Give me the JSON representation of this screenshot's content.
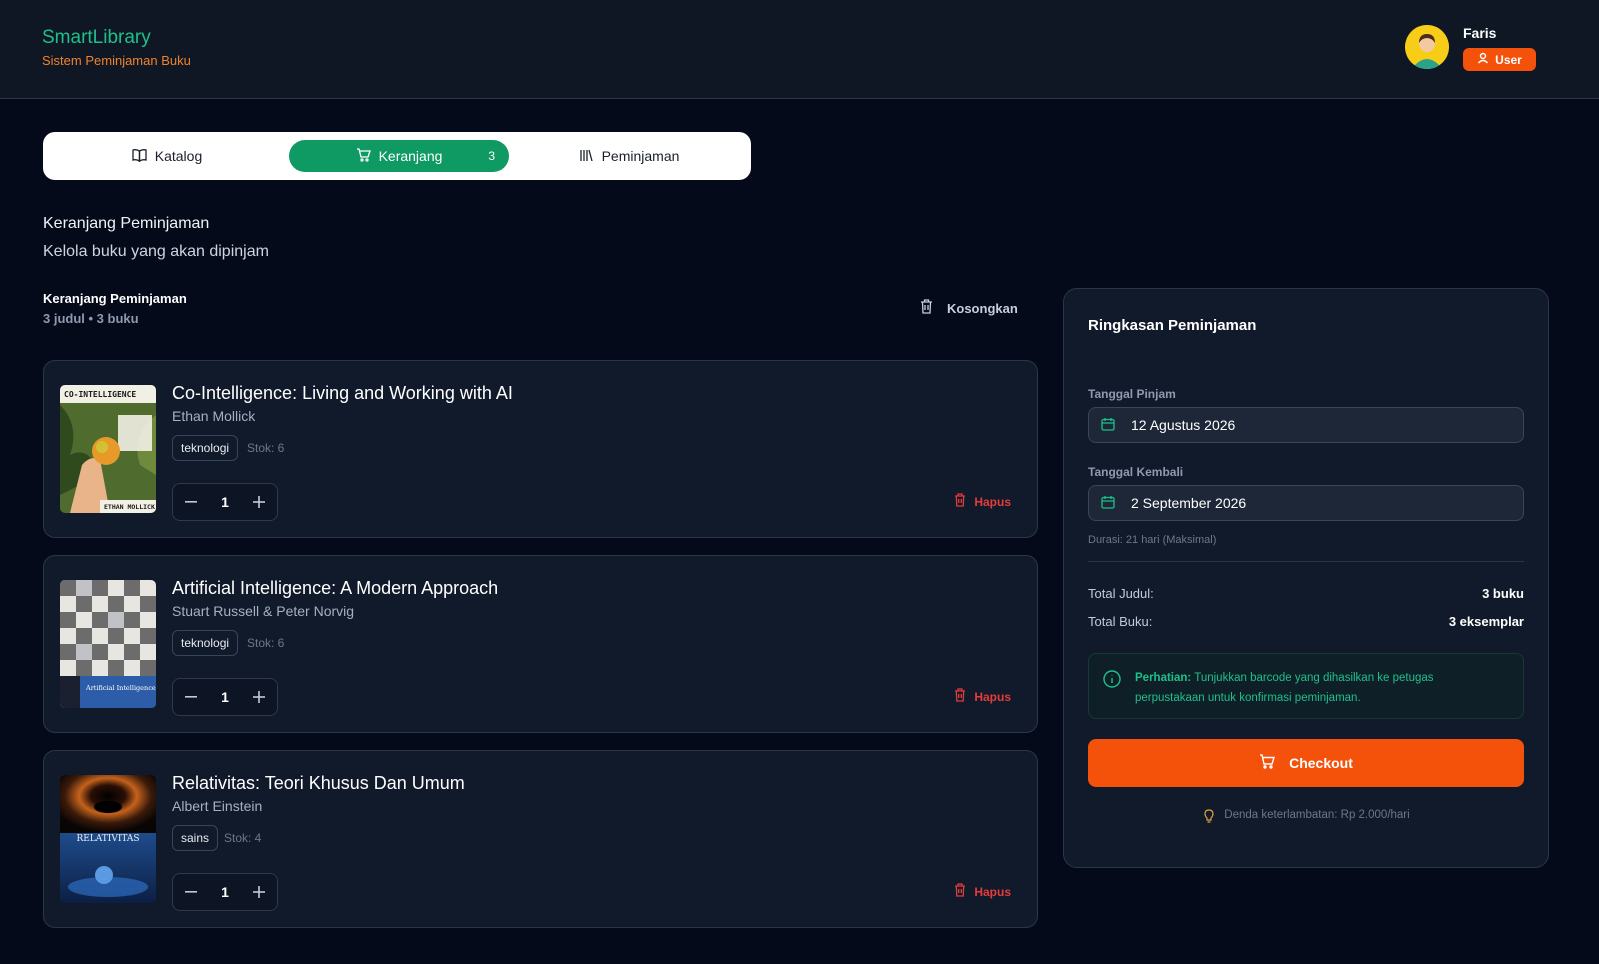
{
  "app": {
    "title": "SmartLibrary",
    "subtitle": "Sistem Peminjaman Buku"
  },
  "user": {
    "name": "Faris",
    "role": "User"
  },
  "tabs": [
    {
      "label": "Katalog"
    },
    {
      "label": "Keranjang",
      "count": "3"
    },
    {
      "label": "Peminjaman"
    }
  ],
  "page": {
    "title": "Keranjang Peminjaman",
    "subtitle": "Kelola buku yang akan dipinjam"
  },
  "cart": {
    "title": "Keranjang Peminjaman",
    "count": "3 judul • 3 buku",
    "empty_label": "Kosongkan",
    "remove_label": "Hapus",
    "items": [
      {
        "title": "Co-Intelligence: Living and Working with AI",
        "author": "Ethan Mollick",
        "category": "teknologi",
        "stock": "Stok: 6",
        "qty": "1",
        "cover_text": "CO-INTELLIGENCE",
        "cover_author": "ETHAN MOLLICK"
      },
      {
        "title": "Artificial Intelligence: A Modern Approach",
        "author": "Stuart Russell & Peter Norvig",
        "category": "teknologi",
        "stock": "Stok: 6",
        "qty": "1",
        "cover_text": "Artificial Intelligence"
      },
      {
        "title": "Relativitas: Teori Khusus Dan Umum",
        "author": "Albert Einstein",
        "category": "sains",
        "stock": "Stok: 4",
        "qty": "1",
        "cover_text": "RELATIVITAS"
      }
    ]
  },
  "summary": {
    "title": "Ringkasan Peminjaman",
    "borrow_label": "Tanggal Pinjam",
    "borrow_date": "12 Agustus 2026",
    "return_label": "Tanggal Kembali",
    "return_date": "2 September 2026",
    "duration": "Durasi: 21 hari (Maksimal)",
    "total_titles_label": "Total Judul:",
    "total_titles": "3 buku",
    "total_books_label": "Total Buku:",
    "total_books": "3 eksemplar",
    "notice_bold": "Perhatian:",
    "notice_text": " Tunjukkan barcode yang dihasilkan ke petugas perpustakaan untuk konfirmasi peminjaman.",
    "checkout_label": "Checkout",
    "fine_text": "Denda keterlambatan: Rp 2.000/hari"
  },
  "colors": {
    "accent_green": "#0f9a63",
    "accent_orange": "#f4510b",
    "danger": "#e43b3b",
    "background": "#050a1a"
  }
}
